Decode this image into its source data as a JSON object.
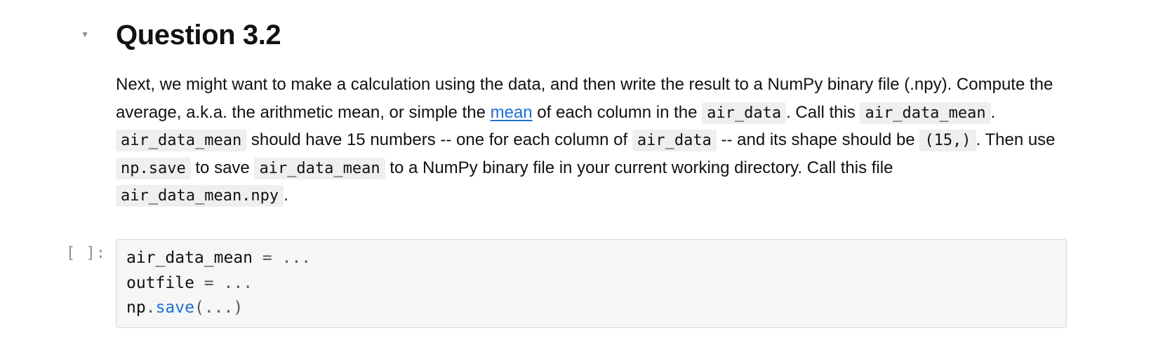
{
  "heading": "Question 3.2",
  "paragraph": {
    "t1": "Next, we might want to make a calculation using the data, and then write the result to a NumPy binary file (.npy). Compute the average, a.k.a. the arithmetic mean, or simple the ",
    "link_mean": "mean",
    "t2": " of each column in the ",
    "code1": "air_data",
    "t3": ". Call this ",
    "code2": "air_data_mean",
    "t4": ". ",
    "code3": "air_data_mean",
    "t5": " should have 15 numbers -- one for each column of ",
    "code4": "air_data",
    "t6": " -- and its shape should be ",
    "code5": "(15,)",
    "t7": ". Then use ",
    "code6": "np.save",
    "t8": " to save ",
    "code7": "air_data_mean",
    "t9": " to a NumPy binary file in your current working directory. Call this file ",
    "code8": "air_data_mean.npy",
    "t10": "."
  },
  "prompt_label": "[ ]:",
  "code": {
    "l1a": "air_data_mean ",
    "l1b": "=",
    "l1c": " ",
    "l1d": "...",
    "l2a": "outfile ",
    "l2b": "=",
    "l2c": " ",
    "l2d": "...",
    "l3a": "np",
    "l3b": ".",
    "l3c": "save",
    "l3d": "(",
    "l3e": "...",
    "l3f": ")"
  }
}
